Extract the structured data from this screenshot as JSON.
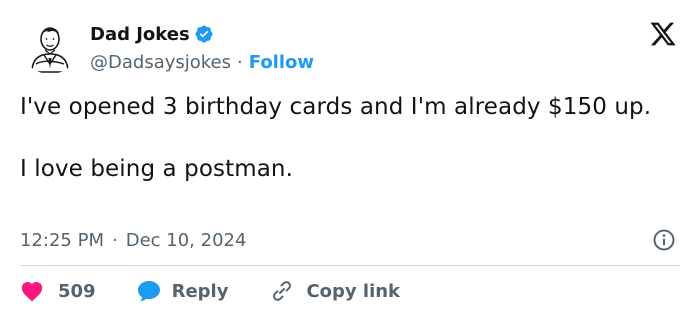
{
  "author": {
    "name": "Dad Jokes",
    "handle": "@Dadsaysjokes",
    "separator": "·",
    "follow_label": "Follow"
  },
  "tweet": {
    "lines": [
      "I've opened 3 birthday cards and I'm already $150 up.",
      "I love being a postman."
    ],
    "time": "12:25 PM",
    "time_separator": "·",
    "date": "Dec 10, 2024"
  },
  "actions": {
    "like_count": "509",
    "reply_label": "Reply",
    "copy_label": "Copy link"
  },
  "colors": {
    "accent": "#1d9bf0",
    "like": "#f91880",
    "text": "#0f1419",
    "muted": "#536471",
    "divider": "#cfd9de"
  },
  "icons": {
    "logo": "x-logo",
    "verified": "verified-badge-icon",
    "info": "info-icon",
    "like": "heart-icon",
    "reply": "speech-bubble-icon",
    "copy": "link-icon"
  }
}
